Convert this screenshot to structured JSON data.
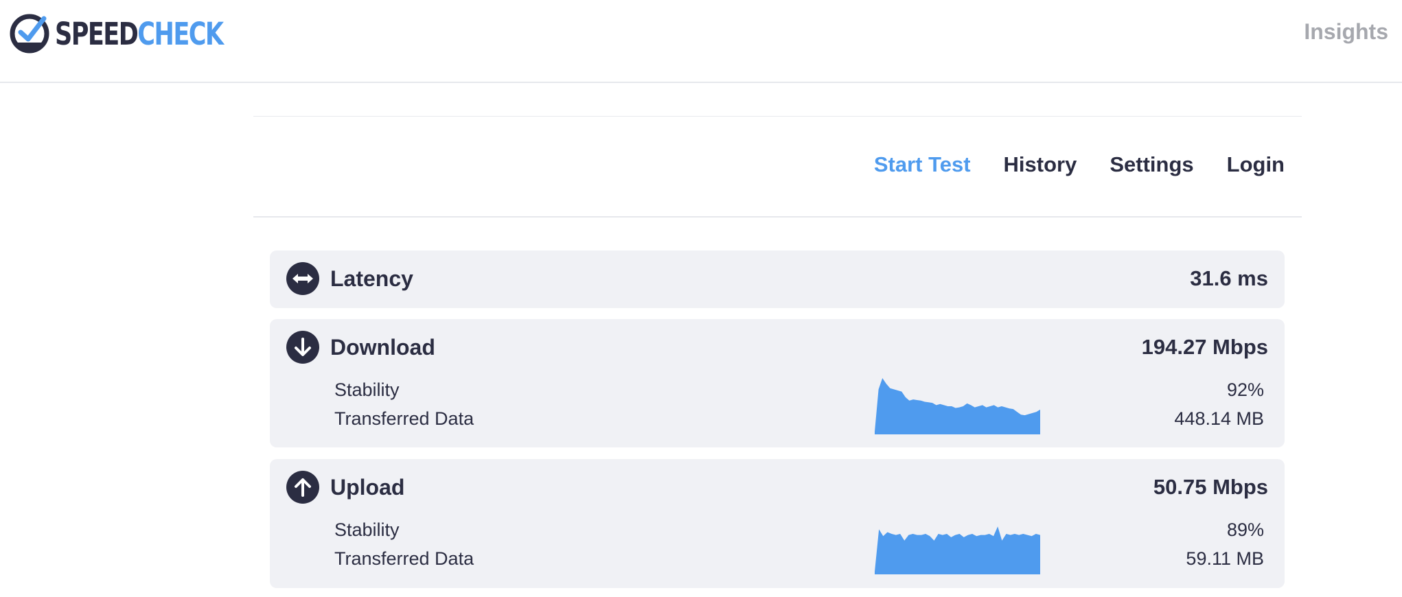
{
  "brand": {
    "name_part1": "SPEED",
    "name_part2": "CHECK",
    "color_dark": "#2b2d42",
    "color_accent": "#4f9bee"
  },
  "header": {
    "insights_link": "Insights"
  },
  "nav": {
    "items": [
      {
        "label": "Start Test",
        "active": true
      },
      {
        "label": "History",
        "active": false
      },
      {
        "label": "Settings",
        "active": false
      },
      {
        "label": "Login",
        "active": false
      }
    ]
  },
  "results": {
    "latency": {
      "label": "Latency",
      "value": "31.6 ms",
      "icon": "horizontal-double-arrow-icon"
    },
    "download": {
      "label": "Download",
      "value": "194.27 Mbps",
      "icon": "arrow-down-icon",
      "stability_label": "Stability",
      "stability_value": "92%",
      "transferred_label": "Transferred Data",
      "transferred_value": "448.14 MB",
      "sparkline_color": "#4f9bee",
      "sparkline": [
        0.05,
        0.8,
        1.0,
        0.9,
        0.82,
        0.8,
        0.78,
        0.76,
        0.66,
        0.6,
        0.62,
        0.61,
        0.6,
        0.58,
        0.57,
        0.56,
        0.52,
        0.54,
        0.52,
        0.5,
        0.5,
        0.47,
        0.48,
        0.5,
        0.55,
        0.52,
        0.48,
        0.5,
        0.52,
        0.48,
        0.5,
        0.52,
        0.48,
        0.5,
        0.48,
        0.46,
        0.45,
        0.4,
        0.35,
        0.34,
        0.36,
        0.38,
        0.4,
        0.44
      ]
    },
    "upload": {
      "label": "Upload",
      "value": "50.75 Mbps",
      "icon": "arrow-up-icon",
      "stability_label": "Stability",
      "stability_value": "89%",
      "transferred_label": "Transferred Data",
      "transferred_value": "59.11 MB",
      "sparkline_color": "#4f9bee",
      "sparkline": [
        0.05,
        0.8,
        0.68,
        0.75,
        0.72,
        0.7,
        0.72,
        0.6,
        0.7,
        0.72,
        0.7,
        0.7,
        0.72,
        0.68,
        0.6,
        0.72,
        0.7,
        0.72,
        0.66,
        0.7,
        0.72,
        0.66,
        0.7,
        0.72,
        0.68,
        0.7,
        0.7,
        0.72,
        0.68,
        0.85,
        0.6,
        0.72,
        0.7,
        0.72,
        0.7,
        0.72,
        0.7,
        0.68,
        0.72,
        0.7
      ]
    }
  }
}
